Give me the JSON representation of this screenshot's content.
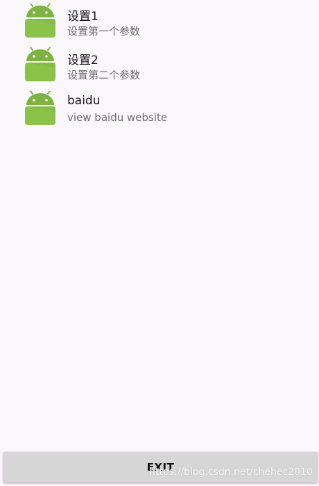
{
  "list": {
    "items": [
      {
        "title": "设置1",
        "subtitle": "设置第一个参数",
        "icon": "android-icon"
      },
      {
        "title": "设置2",
        "subtitle": "设置第二个参数",
        "icon": "android-icon"
      },
      {
        "title": "baidu",
        "subtitle": "view baidu website",
        "icon": "android-icon"
      }
    ]
  },
  "exit_button": {
    "label": "EXIT"
  },
  "watermark": "https://blog.csdn.net/chehec2010",
  "colors": {
    "background": "#faf8fa",
    "android_green": "#8bc34a",
    "button_gray": "#d6d6d6"
  }
}
